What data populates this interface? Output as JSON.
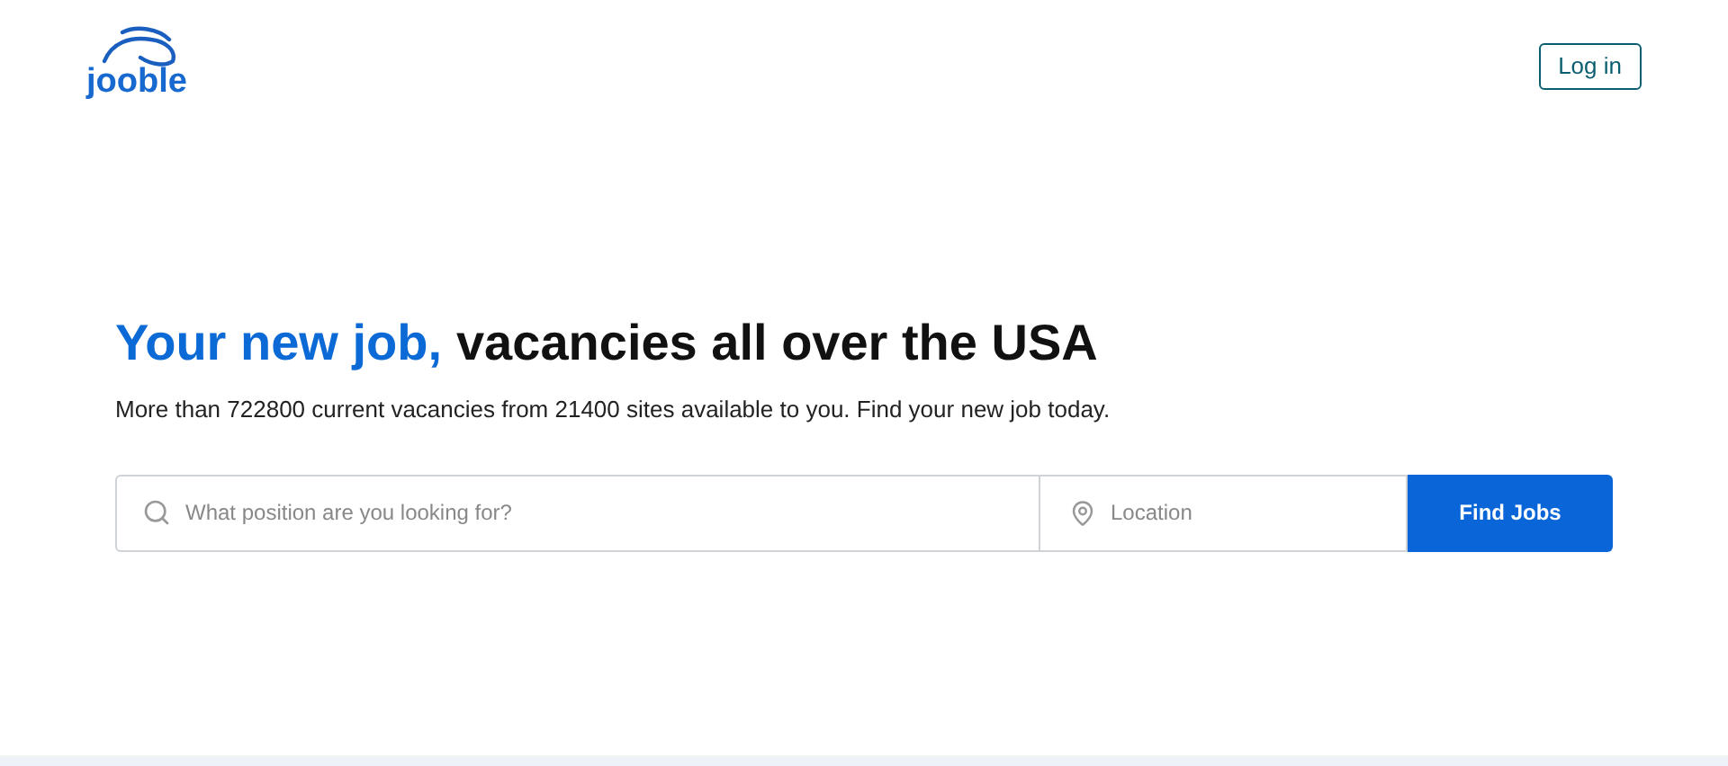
{
  "header": {
    "logo": "jooble",
    "login_button": "Log in"
  },
  "hero": {
    "title_accent": "Your new job,",
    "title_rest": "vacancies all over the USA",
    "subtitle": "More than 722800 current vacancies from 21400 sites available to you. Find your new job today."
  },
  "search": {
    "position_placeholder": "What position are you looking for?",
    "location_placeholder": "Location",
    "button": "Find Jobs"
  }
}
